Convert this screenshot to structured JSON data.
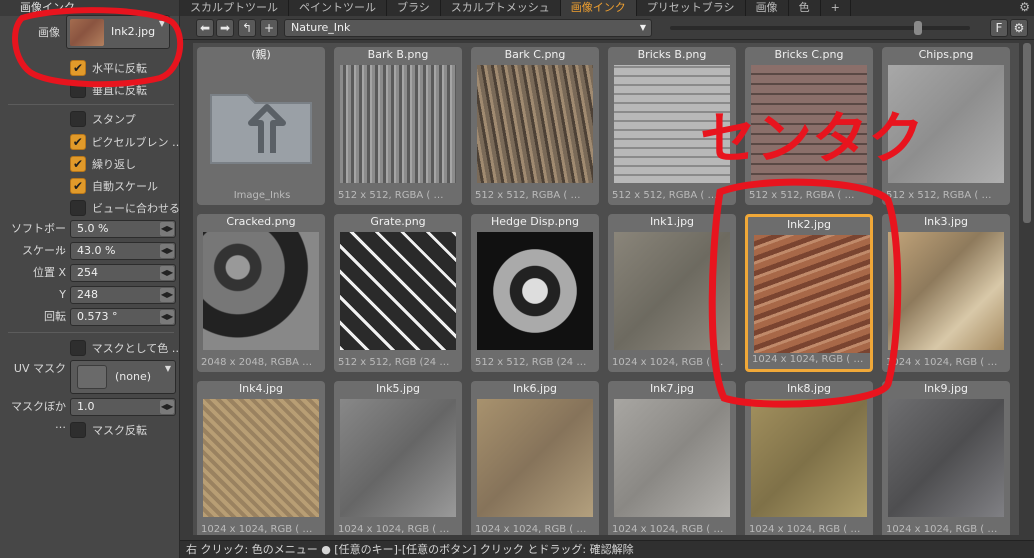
{
  "left_panel": {
    "title": "画像インク",
    "image_label": "画像",
    "image_value": "Ink2.jpg",
    "flip_h": "水平に反転",
    "flip_v": "垂直に反転",
    "stamp": "スタンプ",
    "pixel_blend": "ピクセルブレン …",
    "repeat": "繰り返し",
    "auto_scale": "自動スケール",
    "fit_view": "ビューに合わせる",
    "softness_label": "ソフトボー …",
    "softness_value": "5.0 %",
    "scale_label": "スケール",
    "scale_value": "43.0 %",
    "pos_x_label": "位置 X",
    "pos_x_value": "254",
    "pos_y_label": "Y",
    "pos_y_value": "248",
    "rotation_label": "回転",
    "rotation_value": "0.573 °",
    "mask_as_color": "マスクとして色 …",
    "uv_mask_label": "UV マスク",
    "uv_mask_value": "(none)",
    "mask_blur_label": "マスクぼか …",
    "mask_blur_value": "1.0",
    "mask_invert": "マスク反転"
  },
  "tabs": [
    "スカルプトツール",
    "ペイントツール",
    "ブラシ",
    "スカルプトメッシュ",
    "画像インク",
    "プリセットブラシ",
    "画像",
    "色",
    "+"
  ],
  "toolbar": {
    "path": "Nature_Ink",
    "f_label": "F"
  },
  "items": [
    {
      "name": "(親)",
      "info": "Image_Inks"
    },
    {
      "name": "Bark B.png",
      "info": "512 x 512, RGBA ( …"
    },
    {
      "name": "Bark C.png",
      "info": "512 x 512, RGBA ( …"
    },
    {
      "name": "Bricks B.png",
      "info": "512 x 512, RGBA ( …"
    },
    {
      "name": "Bricks C.png",
      "info": "512 x 512, RGBA ( …"
    },
    {
      "name": "Chips.png",
      "info": "512 x 512, RGBA ( …"
    },
    {
      "name": "Cracked.png",
      "info": "2048 x 2048, RGBA …"
    },
    {
      "name": "Grate.png",
      "info": "512 x 512, RGB (24 …"
    },
    {
      "name": "Hedge Disp.png",
      "info": "512 x 512, RGB (24 …"
    },
    {
      "name": "Ink1.jpg",
      "info": "1024 x 1024, RGB ( …"
    },
    {
      "name": "Ink2.jpg",
      "info": "1024 x 1024, RGB ( …"
    },
    {
      "name": "Ink3.jpg",
      "info": "1024 x 1024, RGB ( …"
    },
    {
      "name": "Ink4.jpg",
      "info": "1024 x 1024, RGB ( …"
    },
    {
      "name": "Ink5.jpg",
      "info": "1024 x 1024, RGB ( …"
    },
    {
      "name": "Ink6.jpg",
      "info": "1024 x 1024, RGB ( …"
    },
    {
      "name": "Ink7.jpg",
      "info": "1024 x 1024, RGB ( …"
    },
    {
      "name": "Ink8.jpg",
      "info": "1024 x 1024, RGB ( …"
    },
    {
      "name": "Ink9.jpg",
      "info": "1024 x 1024, RGB ( …"
    }
  ],
  "annotation_text": "センタク",
  "status": "右 クリック: 色のメニュー ● [任意のキー]-[任意のボタン] クリック とドラッグ: 確認解除"
}
